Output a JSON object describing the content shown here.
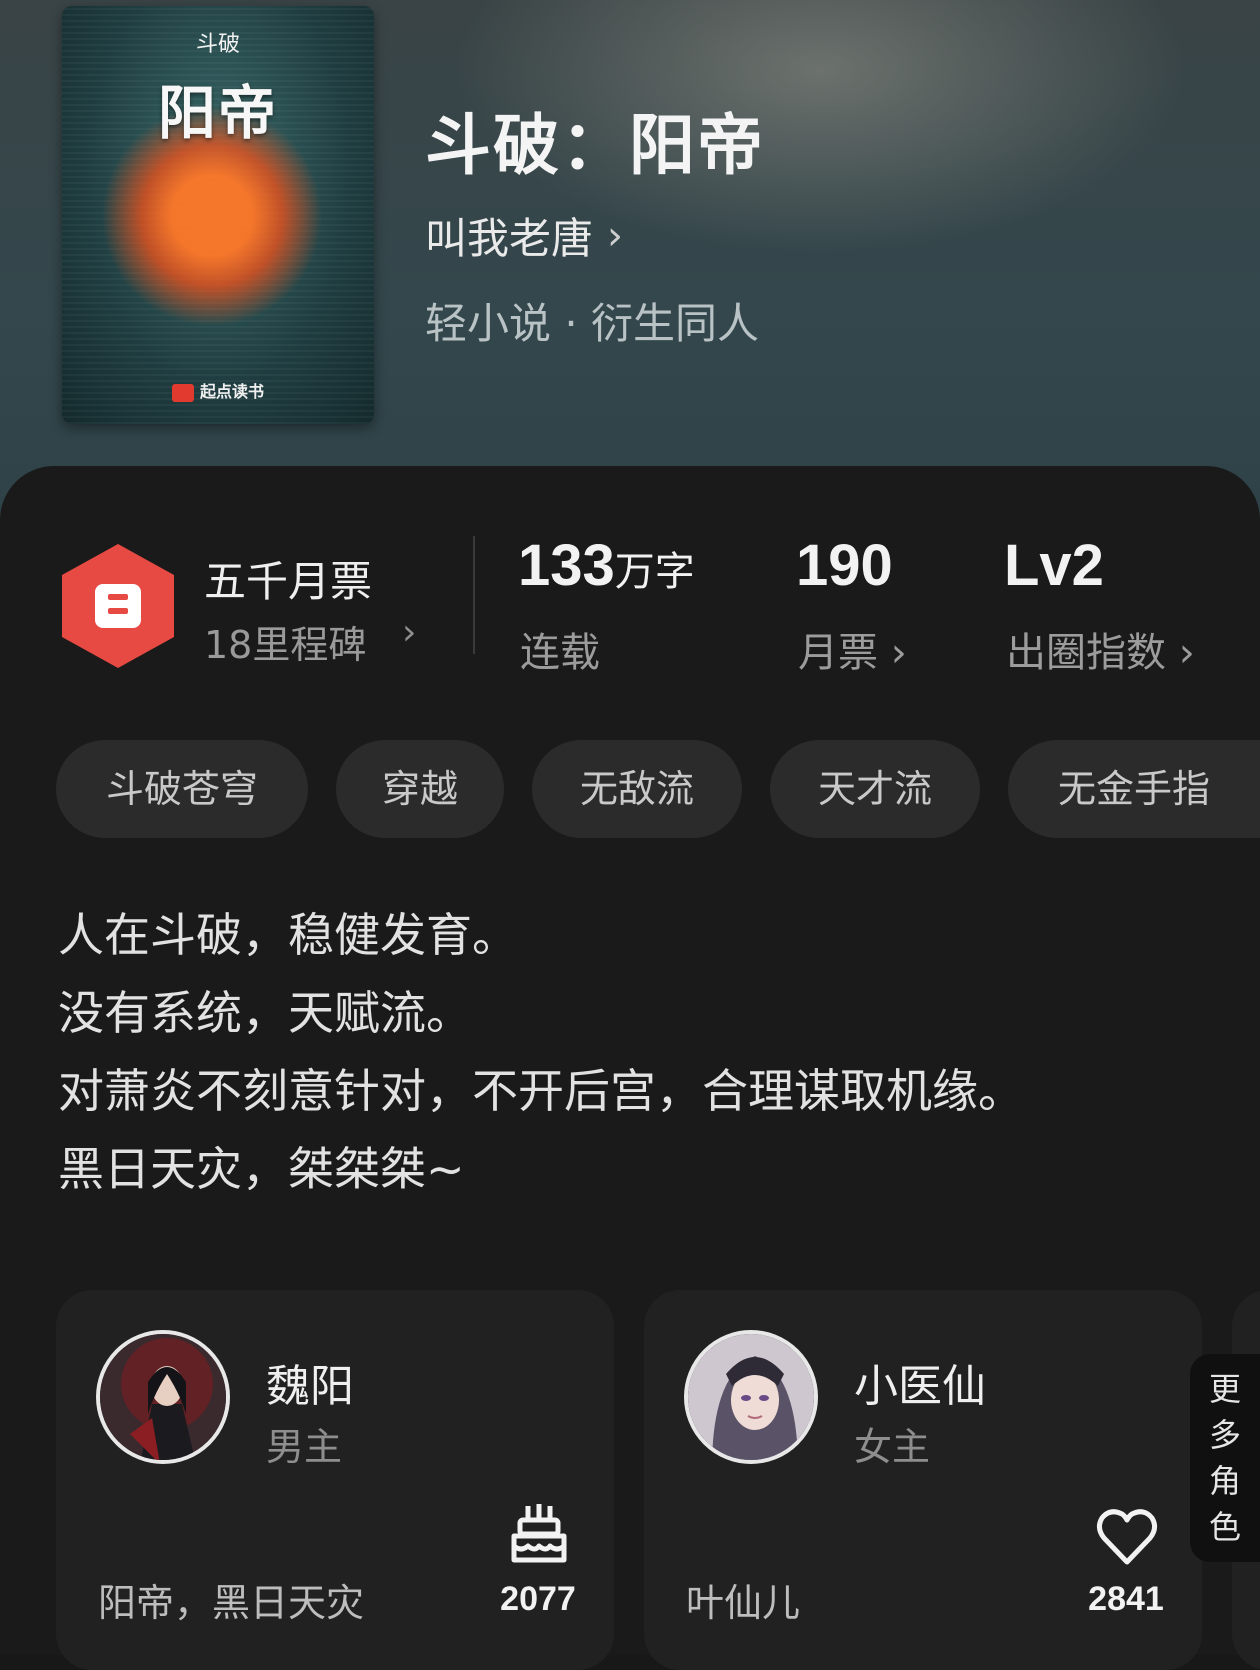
{
  "book": {
    "cover": {
      "series": "斗破",
      "title": "阳帝",
      "publisher": "起点读书"
    },
    "title": "斗破：阳帝",
    "author": "叫我老唐",
    "author_chevron": "›",
    "category": "轻小说 · 衍生同人"
  },
  "milestone": {
    "title": "五千月票",
    "subtitle": "18里程碑",
    "chevron": "›",
    "badge_color": "#e64a43"
  },
  "stats": {
    "words": {
      "value": "133",
      "unit": "万字",
      "label": "连载"
    },
    "tickets": {
      "value": "190",
      "label": "月票 ›"
    },
    "level": {
      "value": "Lv2",
      "label": "出圈指数 ›"
    }
  },
  "tags": [
    "斗破苍穹",
    "穿越",
    "无敌流",
    "天才流",
    "无金手指"
  ],
  "description": [
    "人在斗破，稳健发育。",
    "没有系统，天赋流。",
    "对萧炎不刻意针对，不开后宫，合理谋取机缘。",
    "黑日天灾，桀桀桀~"
  ],
  "characters": [
    {
      "name": "魏阳",
      "role": "男主",
      "tagline": "阳帝，黑日天灾",
      "icon": "cake-icon",
      "count": "2077"
    },
    {
      "name": "小医仙",
      "role": "女主",
      "tagline": "叶仙儿",
      "icon": "heart-icon",
      "count": "2841"
    }
  ],
  "more_roles": [
    "更",
    "多",
    "角",
    "色"
  ]
}
